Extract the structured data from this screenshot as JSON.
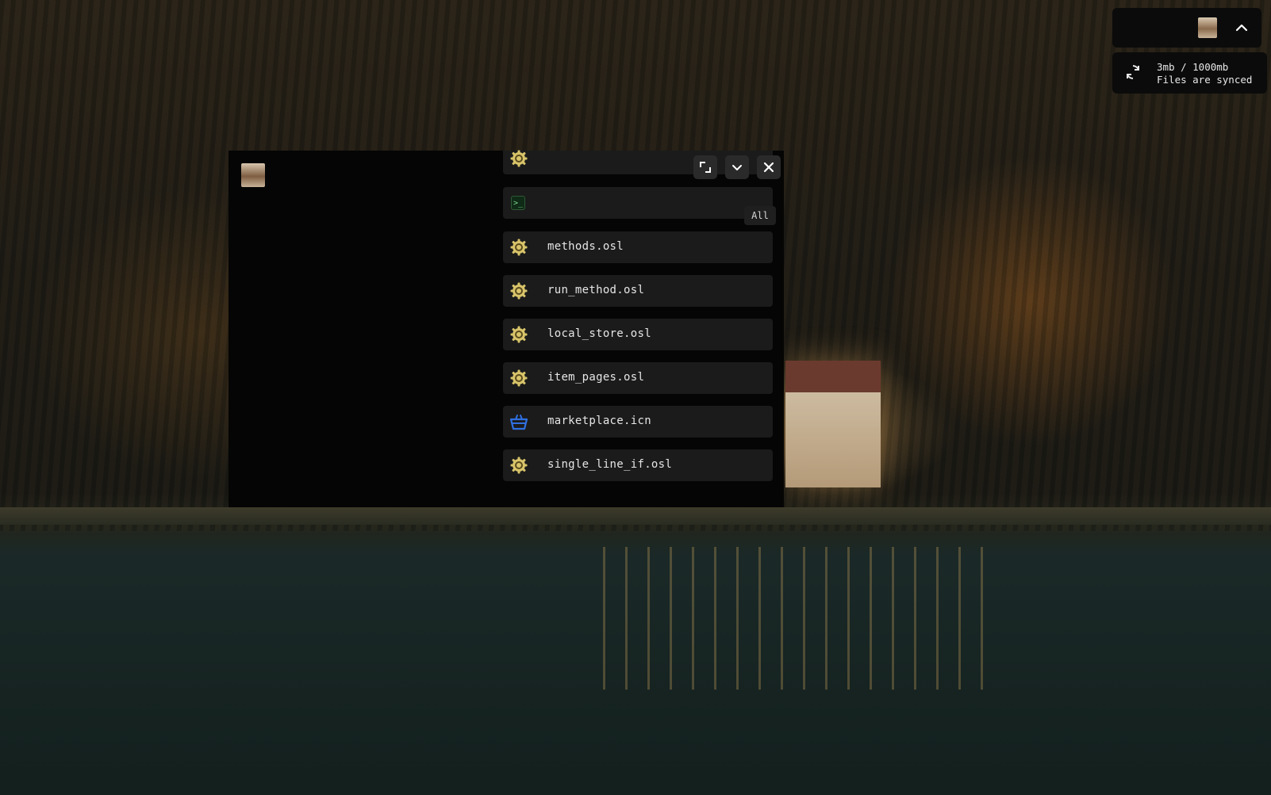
{
  "desktop": {
    "wallpaper_icon": "lake-house-wallpaper"
  },
  "tray": {
    "avatar_icon": "user-avatar-icon",
    "toggle_icon": "chevron-up-icon",
    "storage_usage": "3mb / 1000mb",
    "sync_status": "Files are synced",
    "sync_icon": "sync-icon"
  },
  "window": {
    "avatar_icon": "user-avatar-icon",
    "title_icon": "gear-badge-icon",
    "buttons": {
      "expand_icon": "expand-icon",
      "minimize_icon": "chevron-down-icon",
      "close_icon": "close-icon"
    },
    "command": {
      "icon": "terminal-icon",
      "value": "",
      "placeholder": ""
    },
    "filter_label": "All",
    "files": [
      {
        "name": "methods.osl",
        "icon": "gear-badge-icon"
      },
      {
        "name": "run_method.osl",
        "icon": "gear-badge-icon"
      },
      {
        "name": "local_store.osl",
        "icon": "gear-badge-icon"
      },
      {
        "name": "item_pages.osl",
        "icon": "gear-badge-icon"
      },
      {
        "name": "marketplace.icn",
        "icon": "shopping-basket-icon"
      },
      {
        "name": "single_line_if.osl",
        "icon": "gear-badge-icon"
      }
    ]
  },
  "colors": {
    "gear_icon": "#d8c46a",
    "basket_icon": "#2f6fe0",
    "panel": "#1b1b1b",
    "window_bg": "#050505"
  }
}
